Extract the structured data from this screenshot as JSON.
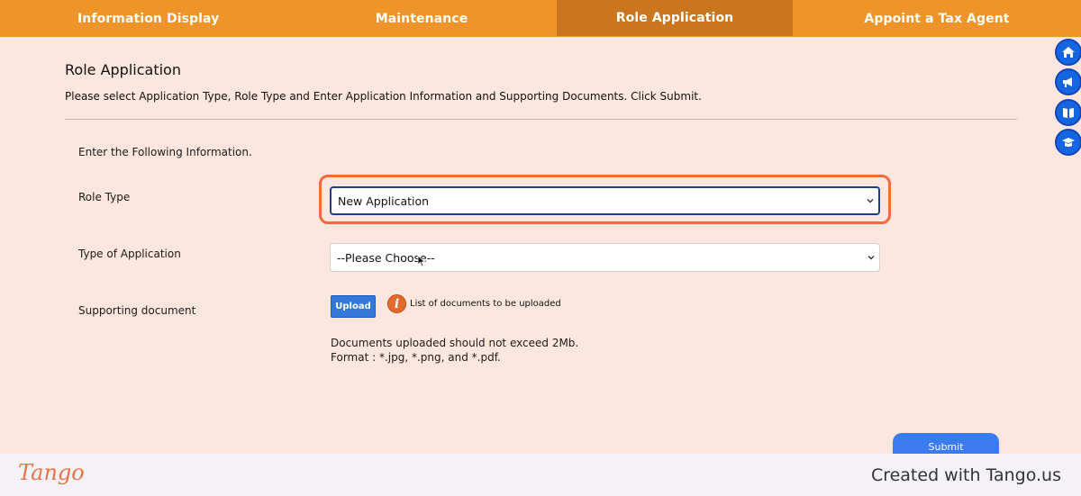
{
  "nav": {
    "tabs": [
      {
        "label": "Information Display"
      },
      {
        "label": "Maintenance"
      },
      {
        "label": "Role Application",
        "active": true
      },
      {
        "label": "Appoint a Tax Agent"
      }
    ],
    "accent": "#ee9428",
    "active_bg": "#c9761e"
  },
  "side_icons": [
    "home-icon",
    "megaphone-icon",
    "book-icon",
    "graduation-cap-icon"
  ],
  "page": {
    "title": "Role Application",
    "description": "Please select Application Type, Role Type and Enter Application Information and Supporting Documents. Click Submit."
  },
  "form": {
    "section_title": "Enter the Following Information.",
    "role_type": {
      "label": "Role Type",
      "value": "New Application"
    },
    "application_type": {
      "label": "Type of Application",
      "value": "--Please Choose--"
    },
    "supporting_document": {
      "label": "Supporting document",
      "upload_label": "Upload",
      "info_link": "List of documents to be uploaded",
      "note_line1": "Documents uploaded should not exceed 2Mb.",
      "note_line2": "Format : *.jpg, *.png, and *.pdf."
    },
    "submit_label": "Submit"
  },
  "footer": {
    "logo": "Tango",
    "text": "Created with Tango.us"
  }
}
